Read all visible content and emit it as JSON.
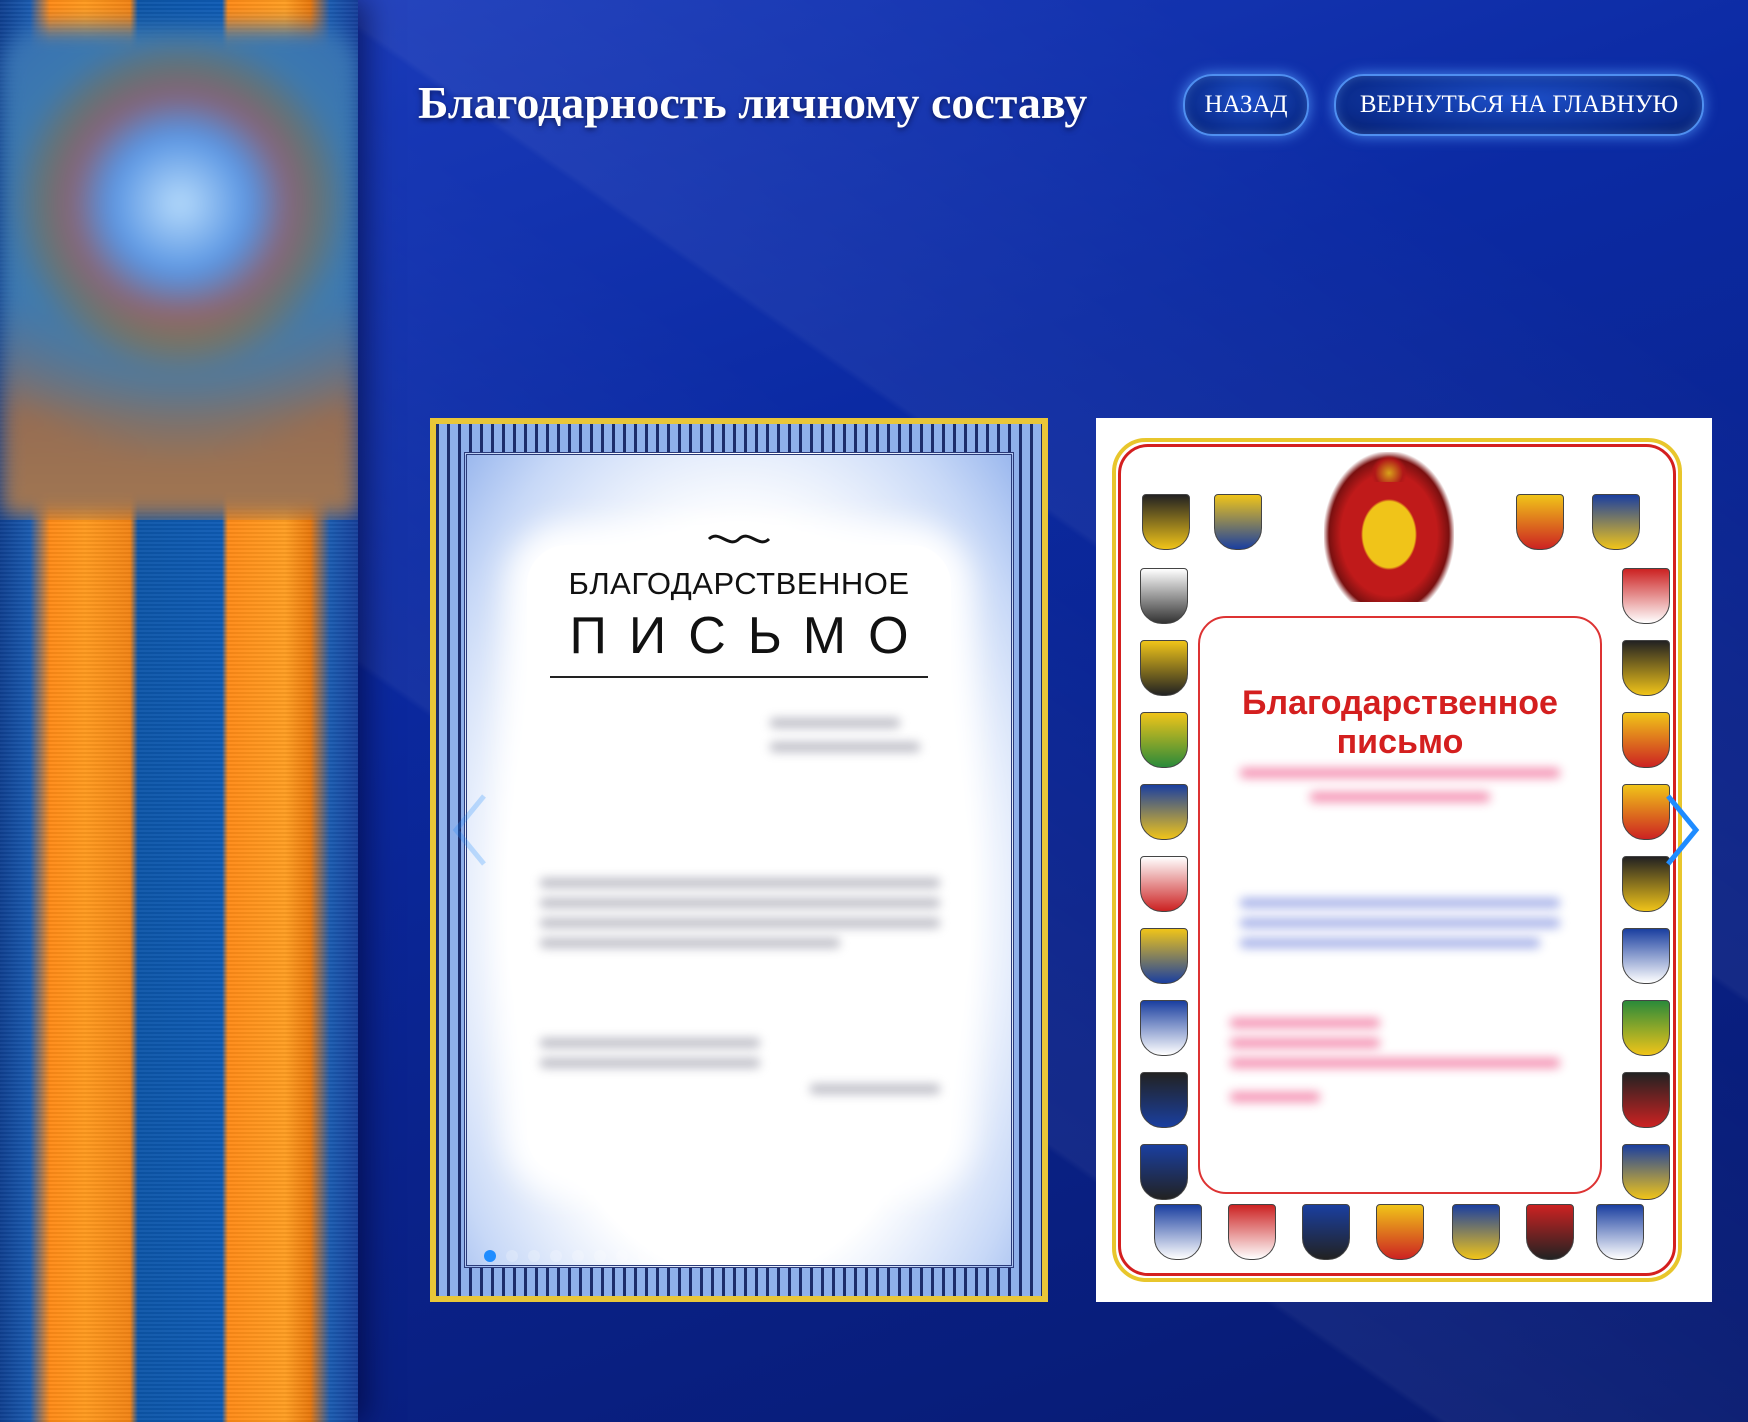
{
  "header": {
    "title": "Благодарность личному составу",
    "back_label": "НАЗАД",
    "home_label": "ВЕРНУТЬСЯ НА ГЛАВНУЮ"
  },
  "gallery": {
    "slide_1": {
      "title_line_1": "БЛАГОДАРСТВЕННОЕ",
      "title_line_2": "ПИСЬМО"
    },
    "slide_2": {
      "title": "Благодарственное письмо"
    },
    "total_dots": 13,
    "active_dot": 1
  },
  "colors": {
    "accent": "#1f8cff",
    "ribbon_orange": "#ff9a1e",
    "ribbon_blue": "#0e5bb4",
    "background": "#0b2aa3",
    "certificate_red": "#d41f1f"
  },
  "icons": {
    "next": "chevron-right-icon",
    "prev": "chevron-left-icon"
  }
}
